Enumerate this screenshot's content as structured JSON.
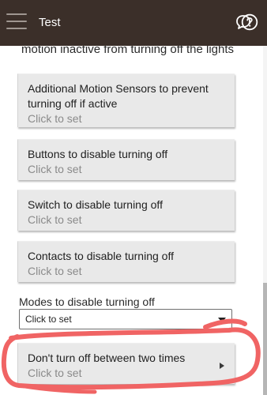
{
  "app": {
    "title": "Test",
    "icons": [
      "menu-icon",
      "chat-bubble-icon",
      "help-icon"
    ],
    "bar_color": "#3b2f29"
  },
  "section": {
    "description": "motion inactive from turning off the lights"
  },
  "cards": [
    {
      "label": "Additional Motion Sensors to prevent turning off if active",
      "sub": "Click to set"
    },
    {
      "label": "Buttons to disable turning off",
      "sub": "Click to set"
    },
    {
      "label": "Switch to disable turning off",
      "sub": "Click to set"
    },
    {
      "label": "Contacts to disable turning off",
      "sub": "Click to set"
    }
  ],
  "modes": {
    "label": "Modes to disable turning off",
    "selected": "Click to set"
  },
  "time_card": {
    "label": "Don't turn off between two times",
    "sub": "Click to set"
  },
  "annotation_color": "#f06464"
}
